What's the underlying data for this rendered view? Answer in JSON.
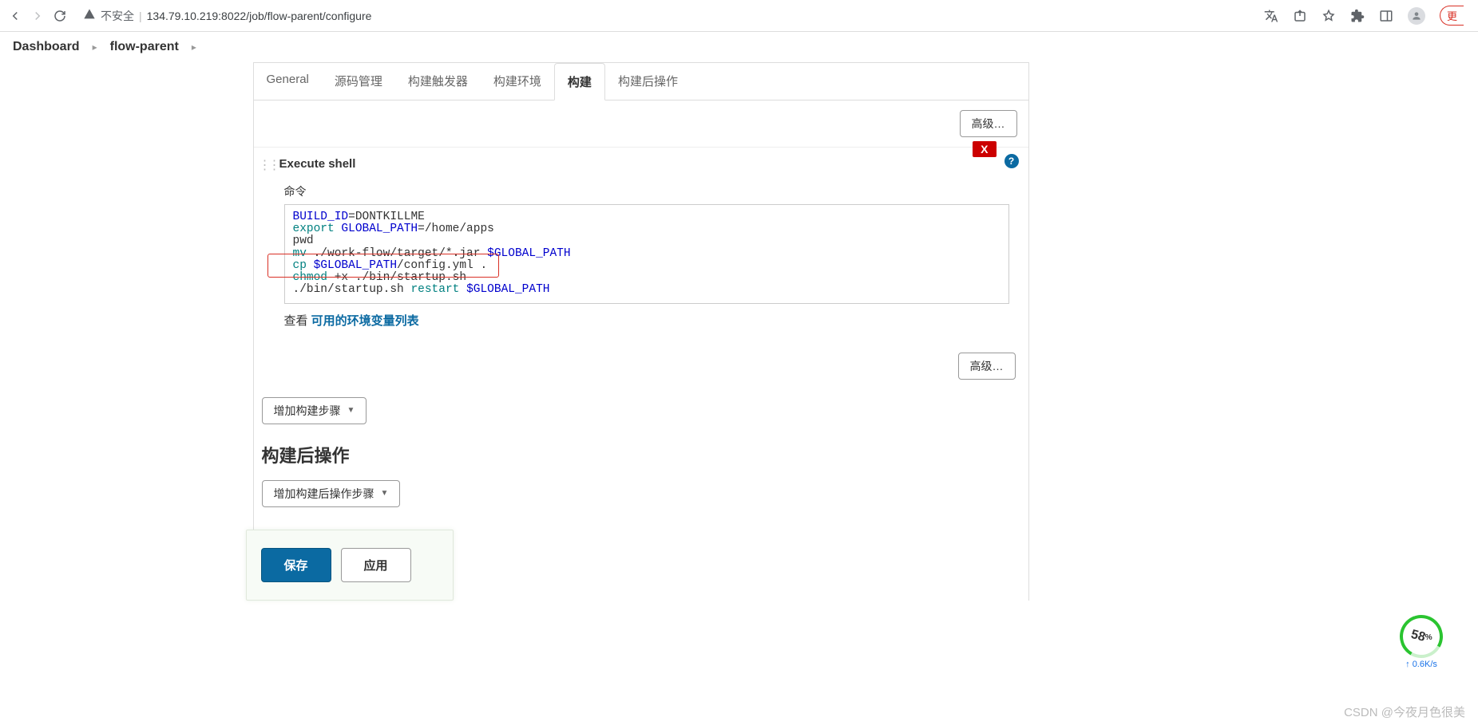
{
  "browser": {
    "security_label": "不安全",
    "url": "134.79.10.219:8022/job/flow-parent/configure",
    "update_label": "更"
  },
  "breadcrumb": {
    "dashboard": "Dashboard",
    "job": "flow-parent"
  },
  "tabs": [
    "General",
    "源码管理",
    "构建触发器",
    "构建环境",
    "构建",
    "构建后操作"
  ],
  "active_tab_index": 4,
  "advanced_label": "高级…",
  "shell": {
    "title": "Execute shell",
    "close_label": "X",
    "field_label": "命令",
    "hint_prefix": "查看 ",
    "hint_link": "可用的环境变量列表",
    "code": {
      "l1_a": "BUILD_ID",
      "l1_b": "=DONTKILLME",
      "l2_a": "export",
      "l2_b": " GLOBAL_PATH",
      "l2_c": "=/home/apps",
      "l3": "pwd",
      "l4_a": "mv",
      "l4_b": " ./work-flow/target/*.jar ",
      "l4_c": "$GLOBAL_PATH",
      "l5_a": "cp",
      "l5_b": " ",
      "l5_c": "$GLOBAL_PATH",
      "l5_d": "/config.yml .",
      "l6_a": "chmod",
      "l6_b": " +x ./bin/startup.sh",
      "l7_a": "./bin/startup.sh ",
      "l7_b": "restart",
      "l7_c": " ",
      "l7_d": "$GLOBAL_PATH"
    }
  },
  "add_build_step": "增加构建步骤",
  "post_build_heading": "构建后操作",
  "add_post_build": "增加构建后操作步骤",
  "buttons": {
    "save": "保存",
    "apply": "应用"
  },
  "watermark": "CSDN @今夜月色很美",
  "speed": {
    "percent": "58",
    "unit": "%",
    "rate": "0.6K/s"
  }
}
